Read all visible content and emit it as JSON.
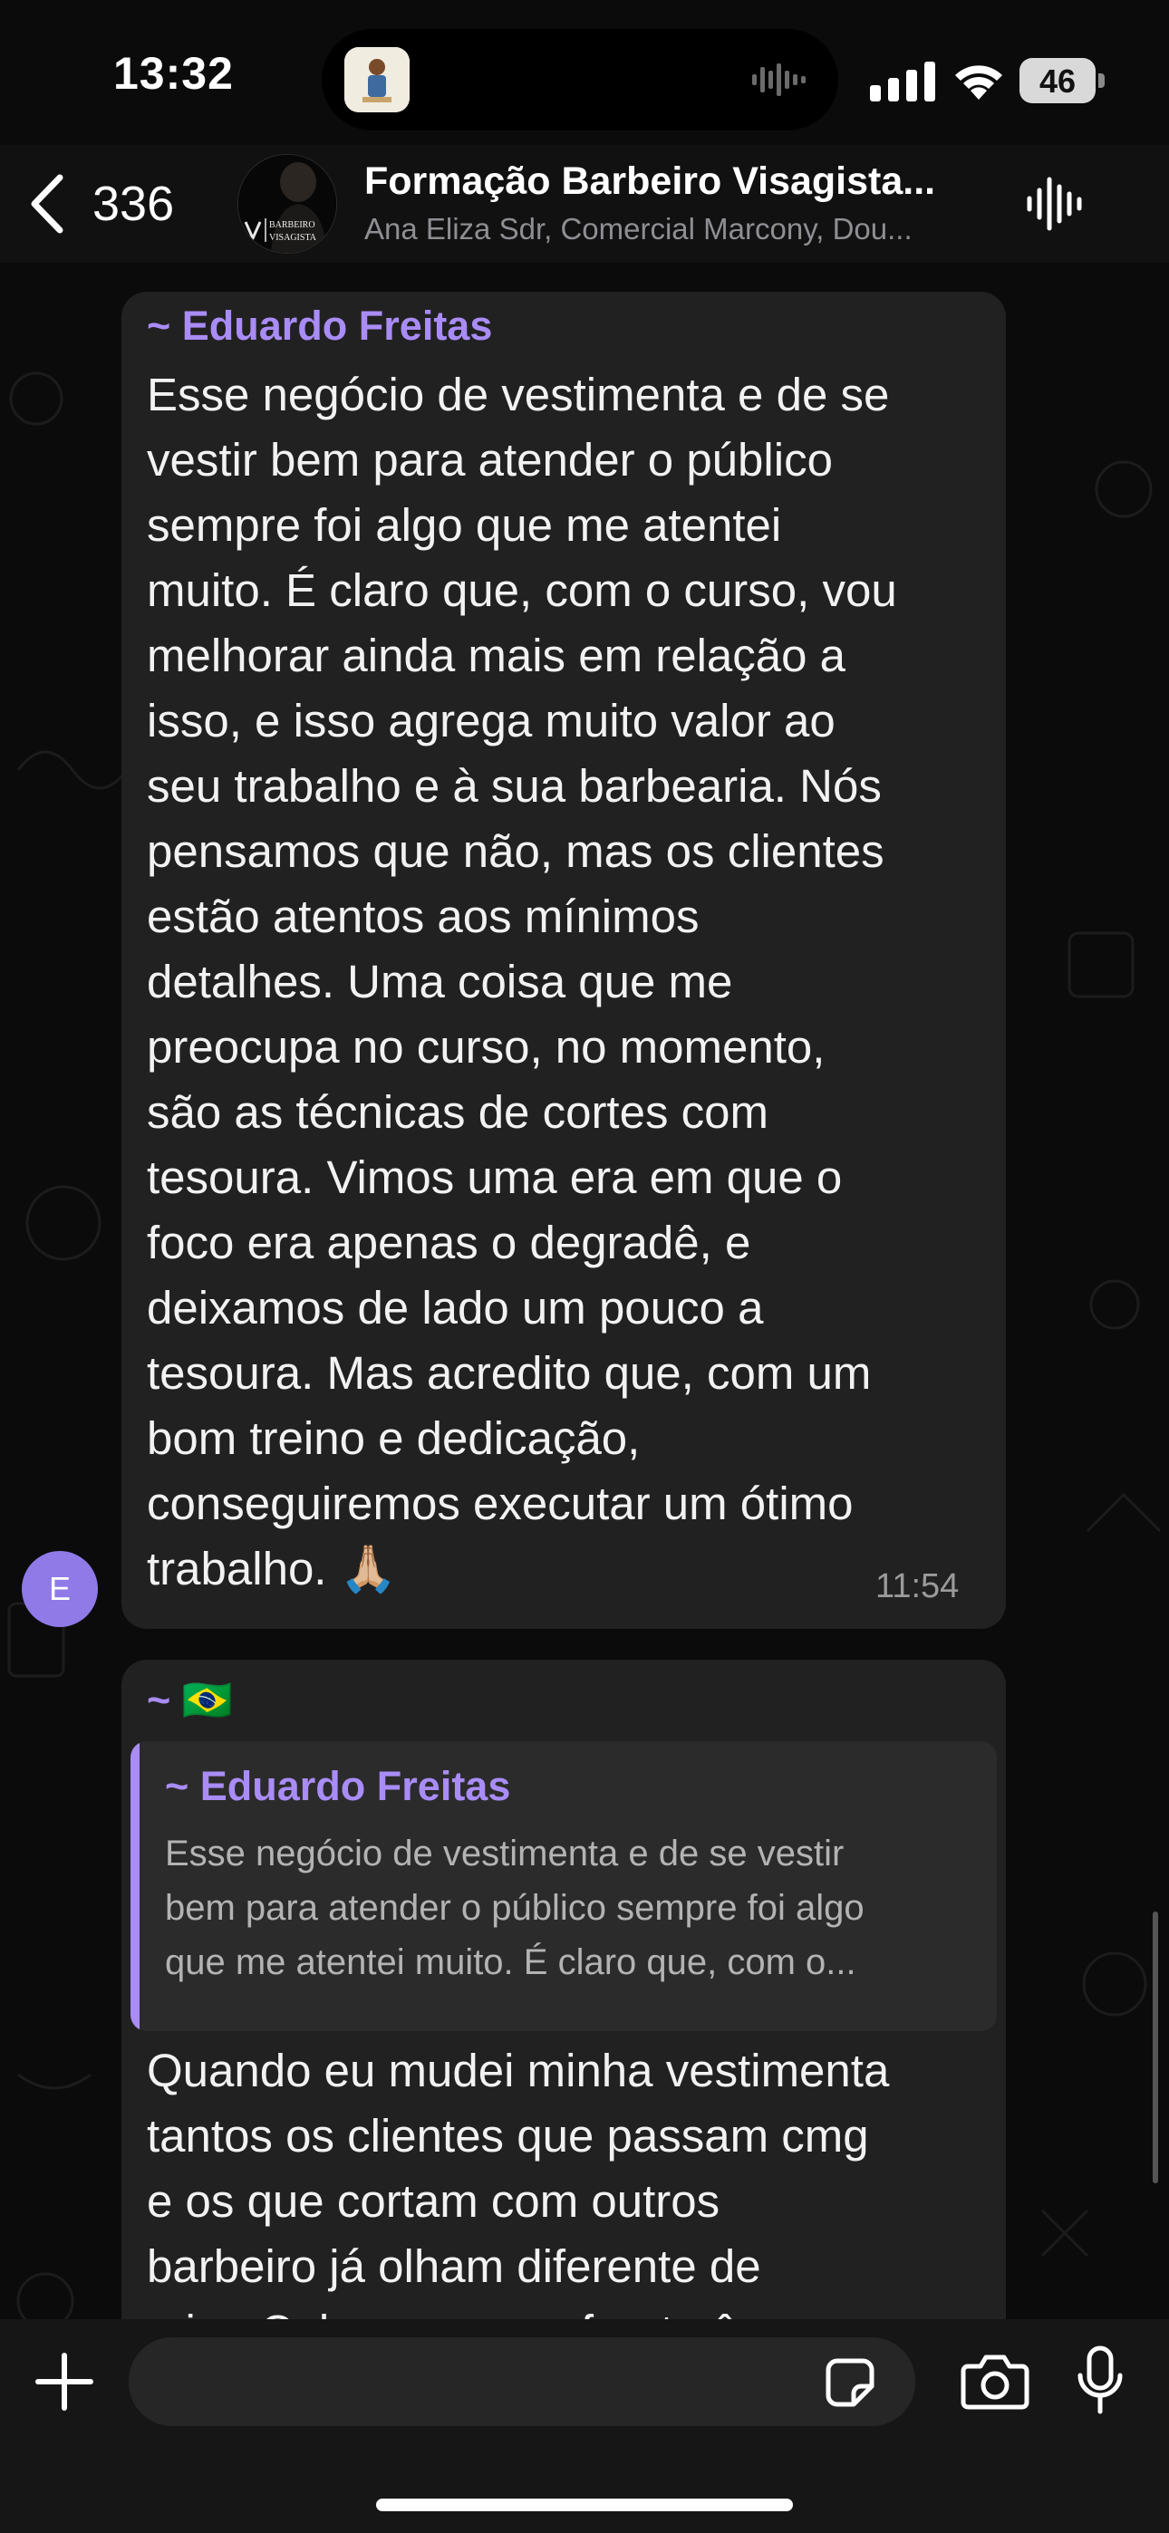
{
  "status_bar": {
    "time": "13:32",
    "battery": "46",
    "icons": [
      "island-app-icon",
      "audio-wave-icon",
      "signal-bars-icon",
      "wifi-icon",
      "battery-icon"
    ]
  },
  "header": {
    "back_count": "336",
    "group_name": "Formação Barbeiro Visagista...",
    "members": "Ana Eliza Sdr, Comercial Marcony, Dou...",
    "avatar_text_line1": "BARBEIRO",
    "avatar_text_line2": "VISAGISTA",
    "icons": [
      "chevron-left-icon",
      "voice-chat-icon"
    ]
  },
  "messages": [
    {
      "sender": "~ Eduardo Freitas",
      "avatar_initial": "E",
      "text": "Esse negócio de vestimenta e de se\nvestir bem para atender o público\nsempre foi algo que me atentei\nmuito. É claro que, com o curso, vou\nmelhorar ainda mais em relação a\nisso, e isso agrega muito valor ao\nseu trabalho e à sua barbearia. Nós\npensamos que não, mas os clientes\nestão atentos aos mínimos\ndetalhes. Uma coisa que me\npreocupa no curso, no momento,\nsão as técnicas de cortes com\ntesoura. Vimos uma era em que o\nfoco era apenas o degradê, e\ndeixamos de lado um pouco a\ntesoura. Mas acredito que, com um\nbom treino e dedicação,\nconseguiremos executar um ótimo\ntrabalho. 🙏🏼",
      "time": "11:54"
    },
    {
      "sender": "~ 🇧🇷",
      "quote_sender": "~ Eduardo Freitas",
      "quote_text": "Esse negócio de vestimenta e de se vestir\nbem para atender o público sempre foi algo\nque me atentei muito. É claro que, com o...",
      "text": "Quando eu mudei minha vestimenta\ntantos os clientes que passam cmg\ne os que cortam com outros\nbarbeiro já olham diferente de\nmim. Coloco mesmo frente ê"
    }
  ],
  "input_bar": {
    "placeholder": "",
    "icons": [
      "plus-icon",
      "sticker-icon",
      "camera-icon",
      "microphone-icon"
    ]
  },
  "colors": {
    "background": "#0b0b0b",
    "bubble": "#212121",
    "sender_name": "#a98cf6",
    "quote_bar": "#a98cf6",
    "time": "#9a9a9a"
  }
}
